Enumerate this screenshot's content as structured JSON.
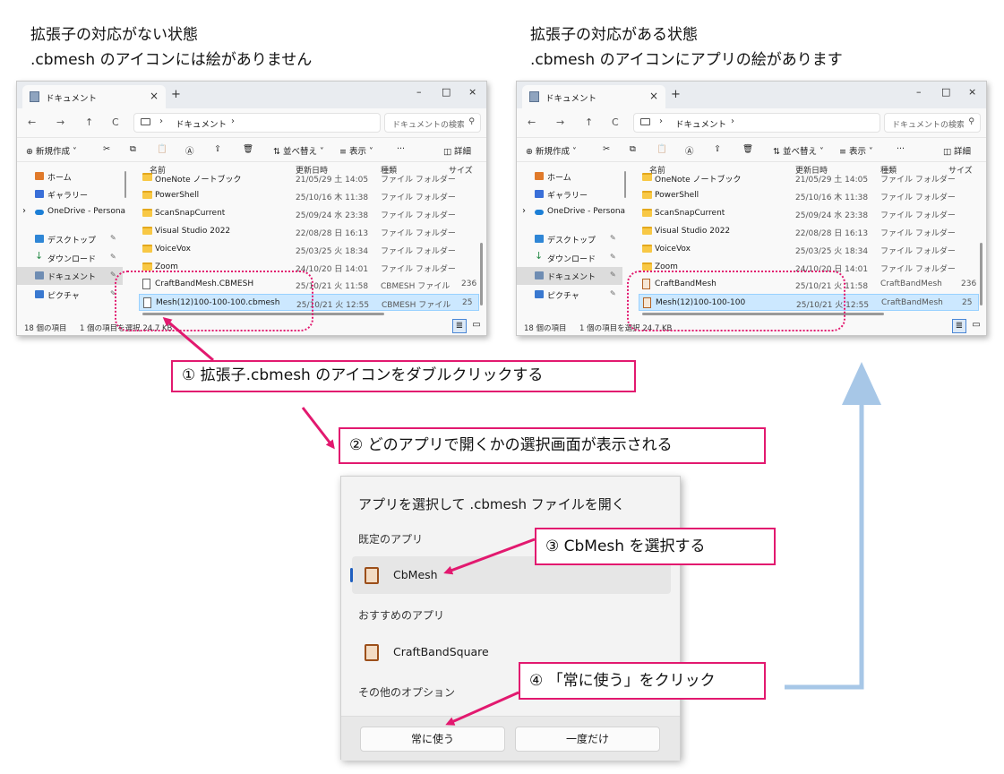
{
  "headings": {
    "left_line1": "拡張子の対応がない状態",
    "left_line2": ".cbmesh のアイコンには絵がありません",
    "right_line1": "拡張子の対応がある状態",
    "right_line2": ".cbmesh のアイコンにアプリの絵があります"
  },
  "explorer": {
    "tab_title": "ドキュメント",
    "tab_close": "×",
    "tab_new": "+",
    "min": "–",
    "max": "□",
    "close": "×",
    "back": "←",
    "forward": "→",
    "up": "↑",
    "refresh": "C",
    "breadcrumb": "ドキュメント",
    "search_placeholder": "ドキュメントの検索",
    "toolbar": {
      "new": "新規作成",
      "cut": "✂",
      "copy": "⧉",
      "paste": "📋",
      "rename": "Ⓐ",
      "share": "⇪",
      "delete": "🗑",
      "sort": "並べ替え",
      "view": "表示",
      "more": "···",
      "details": "詳細"
    },
    "nav_items": [
      {
        "label": "ホーム",
        "color": "#e07a2b"
      },
      {
        "label": "ギャラリー",
        "color": "#3a6fd8"
      },
      {
        "label": "OneDrive - Persona",
        "color": "#1c7fd6"
      },
      {
        "label": "デスクトップ",
        "color": "#2f86d6"
      },
      {
        "label": "ダウンロード",
        "color": "#2a8c4a"
      },
      {
        "label": "ドキュメント",
        "color": "#6f8db3"
      },
      {
        "label": "ピクチャ",
        "color": "#3a79d0"
      }
    ],
    "columns": {
      "name": "名前",
      "date": "更新日時",
      "type": "種類",
      "size": "サイズ"
    },
    "folders": [
      {
        "name": "OneNote ノートブック",
        "date": "21/05/29 土 14:05",
        "type": "ファイル フォルダー"
      },
      {
        "name": "PowerShell",
        "date": "25/10/16 木 11:38",
        "type": "ファイル フォルダー"
      },
      {
        "name": "ScanSnapCurrent",
        "date": "25/09/24 水 23:38",
        "type": "ファイル フォルダー"
      },
      {
        "name": "Visual Studio 2022",
        "date": "22/08/28 日 16:13",
        "type": "ファイル フォルダー"
      },
      {
        "name": "VoiceVox",
        "date": "25/03/25 火 18:34",
        "type": "ファイル フォルダー"
      },
      {
        "name": "Zoom",
        "date": "24/10/20 日 14:01",
        "type": "ファイル フォルダー"
      }
    ],
    "status_items": "18 個の項目",
    "status_selected": "1 個の項目を選択 24.7 KB"
  },
  "left_files": [
    {
      "name": "CraftBandMesh.CBMESH",
      "date": "25/10/21 火 11:58",
      "type": "CBMESH ファイル",
      "size": "236"
    },
    {
      "name": "Mesh(12)100-100-100.cbmesh",
      "date": "25/10/21 火 12:55",
      "type": "CBMESH ファイル",
      "size": "25"
    }
  ],
  "right_files": [
    {
      "name": "CraftBandMesh",
      "date": "25/10/21 火 11:58",
      "type": "CraftBandMesh",
      "size": "236"
    },
    {
      "name": "Mesh(12)100-100-100",
      "date": "25/10/21 火 12:55",
      "type": "CraftBandMesh",
      "size": "25"
    }
  ],
  "dialog": {
    "title": "アプリを選択して .cbmesh ファイルを開く",
    "default_section": "既定のアプリ",
    "default_app": "CbMesh",
    "recommended_section": "おすすめのアプリ",
    "recommended_app": "CraftBandSquare",
    "other_section": "その他のオプション",
    "always_button": "常に使う",
    "once_button": "一度だけ"
  },
  "callouts": {
    "step1": "① 拡張子.cbmesh のアイコンをダブルクリックする",
    "step2": "② どのアプリで開くかの選択画面が表示される",
    "step3": "③ CbMesh を選択する",
    "step4": "④ 「常に使う」をクリック"
  },
  "colors": {
    "accent": "#e2196f",
    "flow_arrow": "#a7c7e7",
    "selection": "#cce8ff"
  }
}
